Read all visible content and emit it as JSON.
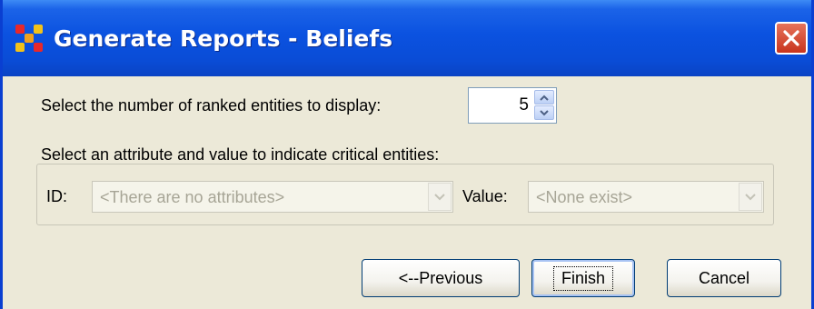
{
  "window": {
    "title": "Generate Reports - Beliefs",
    "close_glyph": "✕"
  },
  "ranked": {
    "label": "Select the number of ranked entities to display:",
    "value": "5"
  },
  "critical": {
    "label": "Select an attribute and value to indicate critical entities:",
    "id_label": "ID:",
    "id_placeholder": "<There are no attributes>",
    "value_label": "Value:",
    "value_placeholder": "<None exist>"
  },
  "buttons": {
    "previous": "<--Previous",
    "finish": "Finish",
    "cancel": "Cancel"
  },
  "icons": {
    "app": "app-grid-icon",
    "close": "close-icon",
    "spin_up": "chevron-up-icon",
    "spin_down": "chevron-down-icon",
    "combo_arrow": "chevron-down-icon"
  },
  "colors": {
    "titlebar": "#0a4cd6",
    "dialog_bg": "#ece9d8",
    "close": "#c8341d",
    "button_border": "#003c74"
  }
}
